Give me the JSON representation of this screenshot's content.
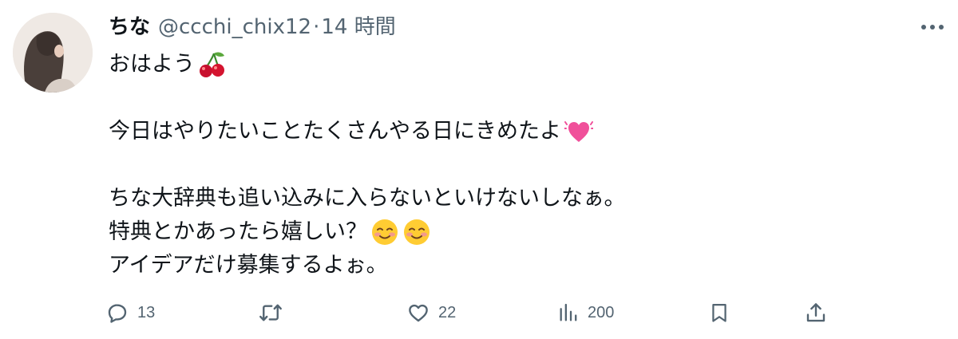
{
  "author": {
    "name": "ちな",
    "handle": "@ccchi_chix12",
    "separator": "·",
    "time": "14 時間"
  },
  "post": {
    "lines": {
      "l1": "おはよう",
      "l2": "今日はやりたいことたくさんやる日にきめたよ",
      "l3": "ちな大辞典も追い込みに入らないといけないしなぁ。",
      "l4": "特典とかあったら嬉しい？",
      "l5": "アイデアだけ募集するよぉ。"
    },
    "emojis": {
      "l1": "cherries-emoji",
      "l2": "beating-heart-emoji",
      "l4": "smiling-face-emoji x2"
    }
  },
  "actions": {
    "reply_count": "13",
    "like_count": "22",
    "view_count": "200"
  },
  "icons": [
    "reply-icon",
    "retweet-icon",
    "like-icon",
    "views-icon",
    "bookmark-icon",
    "share-icon",
    "more-icon"
  ],
  "colors": {
    "text": "#0f1419",
    "secondary": "#536471",
    "background": "#ffffff"
  }
}
